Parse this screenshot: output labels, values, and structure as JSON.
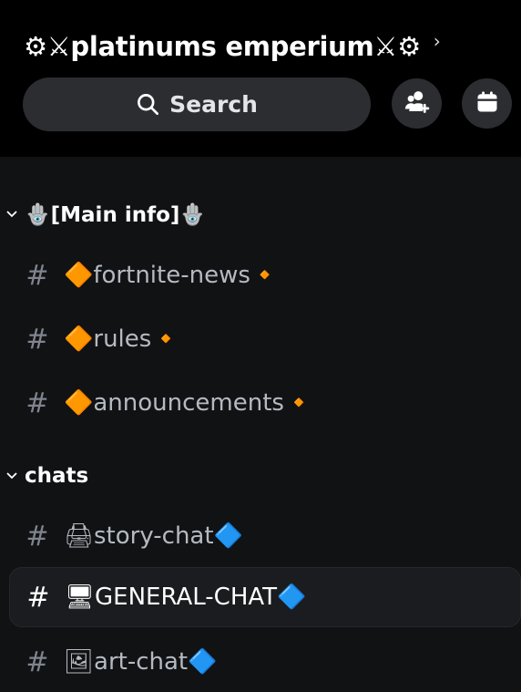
{
  "header": {
    "server_name": "⚙⚔platinums emperium⚔⚙",
    "search_label": "Search",
    "invite_icon": "add-member-icon",
    "events_icon": "calendar-icon"
  },
  "categories": [
    {
      "label": "🪬[Main info]🪬",
      "channels": [
        {
          "name": "🔶fortnite-news🔸"
        },
        {
          "name": "🔶rules🔸"
        },
        {
          "name": "🔶announcements🔸"
        }
      ]
    },
    {
      "label": "chats",
      "channels": [
        {
          "name": "🖨story-chat🔷"
        },
        {
          "name": "🖥GENERAL-CHAT🔷",
          "selected": true
        },
        {
          "name": "🖼art-chat🔷"
        }
      ]
    }
  ],
  "colors": {
    "background": "#111214",
    "header_bg": "#000000",
    "pill_bg": "#2b2d31",
    "selected_bg": "#1b1c1f",
    "text_primary": "#ffffff",
    "text_muted": "#b5bac1"
  }
}
